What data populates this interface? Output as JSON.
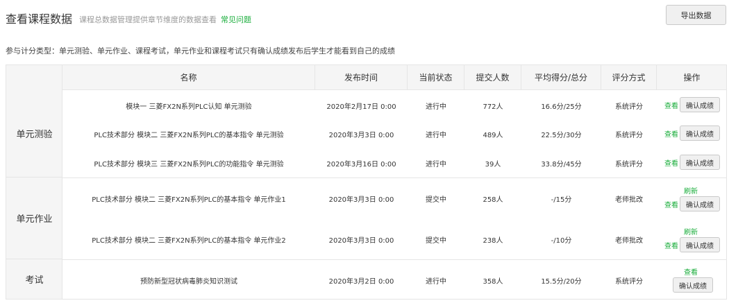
{
  "header": {
    "title": "查看课程数据",
    "subtitle": "课程总数据管理提供章节维度的数据查看",
    "faq": "常见问题",
    "export": "导出数据"
  },
  "notice": "参与计分类型：单元测验、单元作业、课程考试，单元作业和课程考试只有确认成绩发布后学生才能看到自己的成绩",
  "columns": [
    "名称",
    "发布时间",
    "当前状态",
    "提交人数",
    "平均得分/总分",
    "评分方式",
    "操作"
  ],
  "categories": [
    "单元测验",
    "单元作业",
    "考试"
  ],
  "rows": [
    {
      "name": "模块一 三菱FX2N系列PLC认知 单元测验",
      "time": "2020年2月17日 0:00",
      "status": "进行中",
      "count": "772人",
      "score": "16.6分/25分",
      "grading": "系统评分",
      "view": "查看",
      "confirm": "确认成绩"
    },
    {
      "name": "PLC技术部分 模块二 三菱FX2N系列PLC的基本指令 单元测验",
      "time": "2020年3月3日 0:00",
      "status": "进行中",
      "count": "489人",
      "score": "22.5分/30分",
      "grading": "系统评分",
      "view": "查看",
      "confirm": "确认成绩"
    },
    {
      "name": "PLC技术部分 模块三 三菱FX2N系列PLC的功能指令 单元测验",
      "time": "2020年3月16日 0:00",
      "status": "进行中",
      "count": "39人",
      "score": "33.8分/45分",
      "grading": "系统评分",
      "view": "查看",
      "confirm": "确认成绩"
    },
    {
      "name": "PLC技术部分 模块二 三菱FX2N系列PLC的基本指令 单元作业1",
      "time": "2020年3月3日 0:00",
      "status": "提交中",
      "count": "258人",
      "score": "-/15分",
      "grading": "老师批改",
      "refresh": "刷新",
      "view": "查看",
      "confirm": "确认成绩"
    },
    {
      "name": "PLC技术部分 模块二 三菱FX2N系列PLC的基本指令 单元作业2",
      "time": "2020年3月3日 0:00",
      "status": "提交中",
      "count": "238人",
      "score": "-/10分",
      "grading": "老师批改",
      "refresh": "刷新",
      "view": "查看",
      "confirm": "确认成绩"
    },
    {
      "name": "预防新型冠状病毒肺炎知识测试",
      "time": "2020年3月2日 0:00",
      "status": "进行中",
      "count": "358人",
      "score": "15.5分/20分",
      "grading": "系统评分",
      "view": "查看",
      "confirm": "确认成绩"
    }
  ]
}
